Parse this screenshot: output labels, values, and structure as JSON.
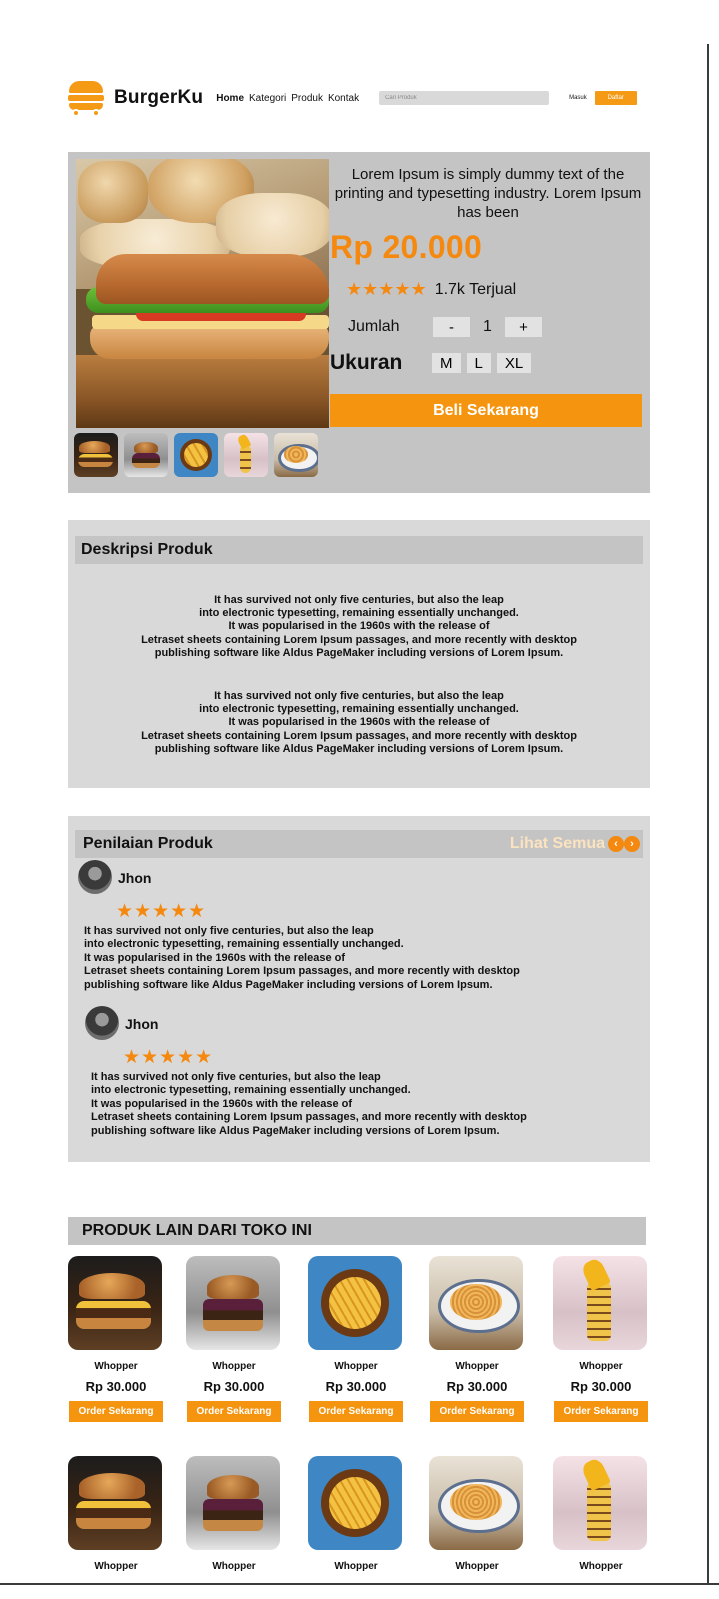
{
  "navbar": {
    "brand": "BurgerKu",
    "links": [
      "Home",
      "Kategori",
      "Produk",
      "Kontak"
    ],
    "search_placeholder": "Cari Produk",
    "login": "Masuk",
    "register": "Daftar"
  },
  "product": {
    "description": "Lorem Ipsum is simply dummy text of the printing and typesetting industry. Lorem  Ipsum has been",
    "price": "Rp 20.000",
    "stars": "★★★★★",
    "sold": "1.7k Terjual",
    "qty_label": "Jumlah",
    "qty_minus": "-",
    "qty_value": "1",
    "qty_plus": "+",
    "size_label": "Ukuran",
    "sizes": [
      "M",
      "L",
      "XL"
    ],
    "buy": "Beli Sekarang"
  },
  "description_section": {
    "title": "Deskripsi Produk",
    "paragraphs": [
      [
        "It has survived not only five centuries, but also the leap",
        "into electronic typesetting, remaining essentially unchanged.",
        "It was popularised in the 1960s with the release of",
        "Letraset sheets containing Lorem Ipsum passages, and more recently with desktop",
        "publishing software like Aldus PageMaker including versions of Lorem Ipsum."
      ],
      [
        "It has survived not only five centuries, but also the leap",
        "into electronic typesetting, remaining essentially unchanged.",
        "It was popularised in the 1960s with the release of",
        "Letraset sheets containing Lorem Ipsum passages, and more recently with desktop",
        "publishing software like Aldus PageMaker including versions of Lorem Ipsum."
      ]
    ]
  },
  "reviews_section": {
    "title": "Penilaian Produk",
    "see_all": "Lihat Semua",
    "prev": "‹",
    "next": "›",
    "reviews": [
      {
        "name": "Jhon",
        "stars": "★★★★★",
        "lines": [
          "It has survived not only five centuries, but also the leap",
          "into electronic typesetting, remaining essentially unchanged.",
          "It was popularised in the 1960s with the release of",
          "Letraset sheets containing Lorem Ipsum passages, and more recently with desktop",
          "publishing software like Aldus PageMaker including versions of Lorem Ipsum."
        ]
      },
      {
        "name": "Jhon",
        "stars": "★★★★★",
        "lines": [
          "It has survived not only five centuries, but also the leap",
          "into electronic typesetting, remaining essentially unchanged.",
          "It was popularised in the 1960s with the release of",
          "Letraset sheets containing Lorem Ipsum passages, and more recently with desktop",
          "publishing software like Aldus PageMaker including versions of Lorem Ipsum."
        ]
      }
    ]
  },
  "other_products": {
    "title": "PRODUK LAIN DARI TOKO INI",
    "items": [
      {
        "name": "Whopper",
        "price": "Rp 30.000",
        "order": "Order Sekarang",
        "image": "burger-photo"
      },
      {
        "name": "Whopper",
        "price": "Rp 30.000",
        "order": "Order Sekarang",
        "image": "burger-photo"
      },
      {
        "name": "Whopper",
        "price": "Rp 30.000",
        "order": "Order Sekarang",
        "image": "fries-photo"
      },
      {
        "name": "Whopper",
        "price": "Rp 30.000",
        "order": "Order Sekarang",
        "image": "pasta-photo"
      },
      {
        "name": "Whopper",
        "price": "Rp 30.000",
        "order": "Order Sekarang",
        "image": "sauce-fries-photo"
      },
      {
        "name": "Whopper",
        "image": "burger-photo"
      },
      {
        "name": "Whopper",
        "image": "burger-photo"
      },
      {
        "name": "Whopper",
        "image": "fries-photo"
      },
      {
        "name": "Whopper",
        "image": "pasta-photo"
      },
      {
        "name": "Whopper",
        "image": "sauce-fries-photo"
      }
    ]
  },
  "colors": {
    "accent": "#f5940e",
    "panel": "#d9d9d9",
    "panel_header": "#c4c4c4"
  }
}
